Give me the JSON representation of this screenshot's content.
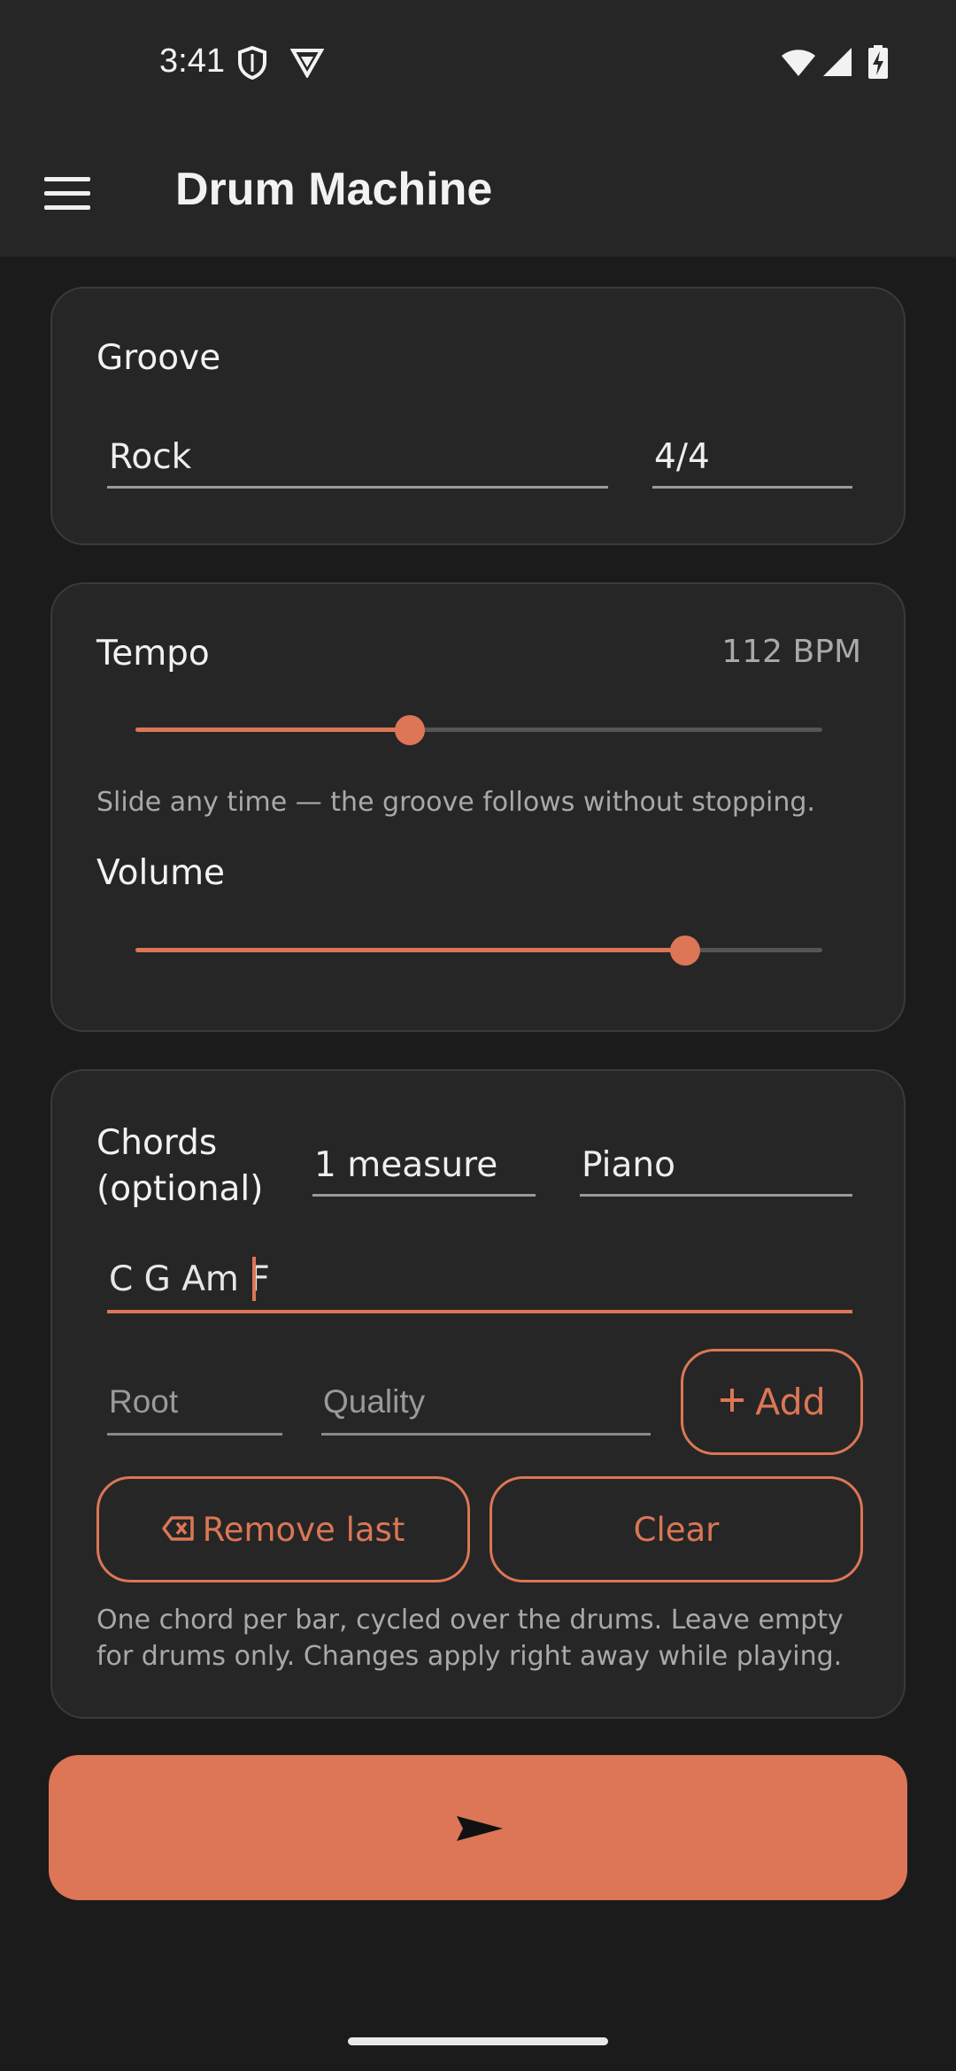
{
  "status_bar": {
    "time": "3:41",
    "icons": [
      "shield-icon",
      "vpn-icon",
      "wifi-icon",
      "cellular-signal-icon",
      "battery-charging-icon"
    ]
  },
  "app_bar": {
    "menu_icon": "hamburger-menu-icon",
    "title": "Drum Machine"
  },
  "groove": {
    "title": "Groove",
    "style_value": "Rock",
    "time_signature_value": "4/4"
  },
  "tempo": {
    "title": "Tempo",
    "bpm_label": "112 BPM",
    "slider_fraction": 0.4,
    "hint": "Slide any time — the groove follows without stopping."
  },
  "volume": {
    "title": "Volume",
    "slider_fraction": 0.8
  },
  "chords": {
    "title_line1": "Chords",
    "title_line2": "(optional)",
    "length_value": "1 measure",
    "instrument_value": "Piano",
    "progression_value": "C G Am F",
    "root_placeholder": "Root",
    "quality_placeholder": "Quality",
    "add_label": "Add",
    "remove_last_label": "Remove last",
    "clear_label": "Clear",
    "hint": "One chord per bar, cycled over the drums. Leave empty for drums only. Changes apply right away while playing."
  },
  "play_button": {
    "icon": "play-icon"
  },
  "colors": {
    "accent": "#dc7656",
    "background": "#1b1b1b",
    "card": "#262626",
    "text": "#eeeeee",
    "muted_text": "#a9a9a9"
  }
}
